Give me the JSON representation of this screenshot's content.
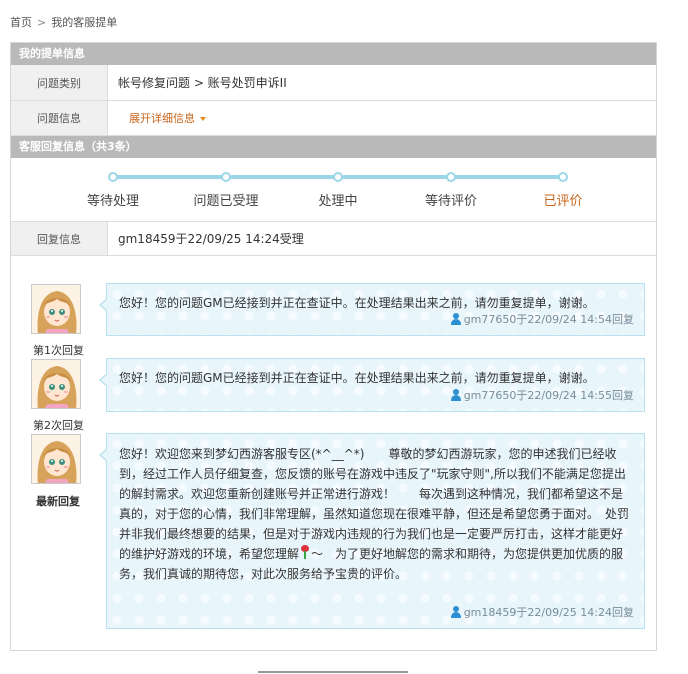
{
  "breadcrumb": {
    "home": "首页",
    "separator": ">",
    "current": "我的客服提单"
  },
  "ticket_section": {
    "title": "我的提单信息",
    "category_label": "问题类别",
    "category_value": "帐号修复问题 > 账号处罚申诉II",
    "info_label": "问题信息",
    "expand_text": "展开详细信息"
  },
  "reply_section": {
    "title": "客服回复信息（共3条）",
    "steps": [
      "等待处理",
      "问题已受理",
      "处理中",
      "等待评价",
      "已评价"
    ],
    "active_step": "已评价",
    "reply_label": "回复信息",
    "reply_value": "gm18459于22/09/25 14:24受理"
  },
  "replies": [
    {
      "caption": "第1次回复",
      "message": "您好！您的问题GM已经接到并正在查证中。在处理结果出来之前，请勿重复提单，谢谢。",
      "meta": "gm77650于22/09/24 14:54回复"
    },
    {
      "caption": "第2次回复",
      "message": "您好！您的问题GM已经接到并正在查证中。在处理结果出来之前，请勿重复提单，谢谢。",
      "meta": "gm77650于22/09/24 14:55回复"
    },
    {
      "caption": "最新回复",
      "message_part1": "您好！欢迎您来到梦幻西游客服专区(*^__^*)　　尊敬的梦幻西游玩家，您的申述我们已经收到，经过工作人员仔细复查，您反馈的账号在游戏中违反了\"玩家守则\",所以我们不能满足您提出的解封需求。欢迎您重新创建账号并正常进行游戏！　　每次遇到这种情况，我们都希望这不是真的，对于您的心情，我们非常理解，虽然知道您现在很难平静，但还是希望您勇于面对。　处罚并非我们最终想要的结果，但是对于游戏内违规的行为我们也是一定要严厉打击，这样才能更好的维护好游戏的环境，希望您理解",
      "message_part2": "～　为了更好地解您的需求和期待，为您提供更加优质的服务，我们真诚的期待您，对此次服务给予宝贵的评价。",
      "meta": "gm18459于22/09/25 14:24回复"
    }
  ],
  "colors": {
    "accent": "#c7651a",
    "track": "#9dd5e9",
    "bubble": "#e8f6fc",
    "header": "#b9b9b9",
    "link_blue": "#2c8fd1"
  }
}
